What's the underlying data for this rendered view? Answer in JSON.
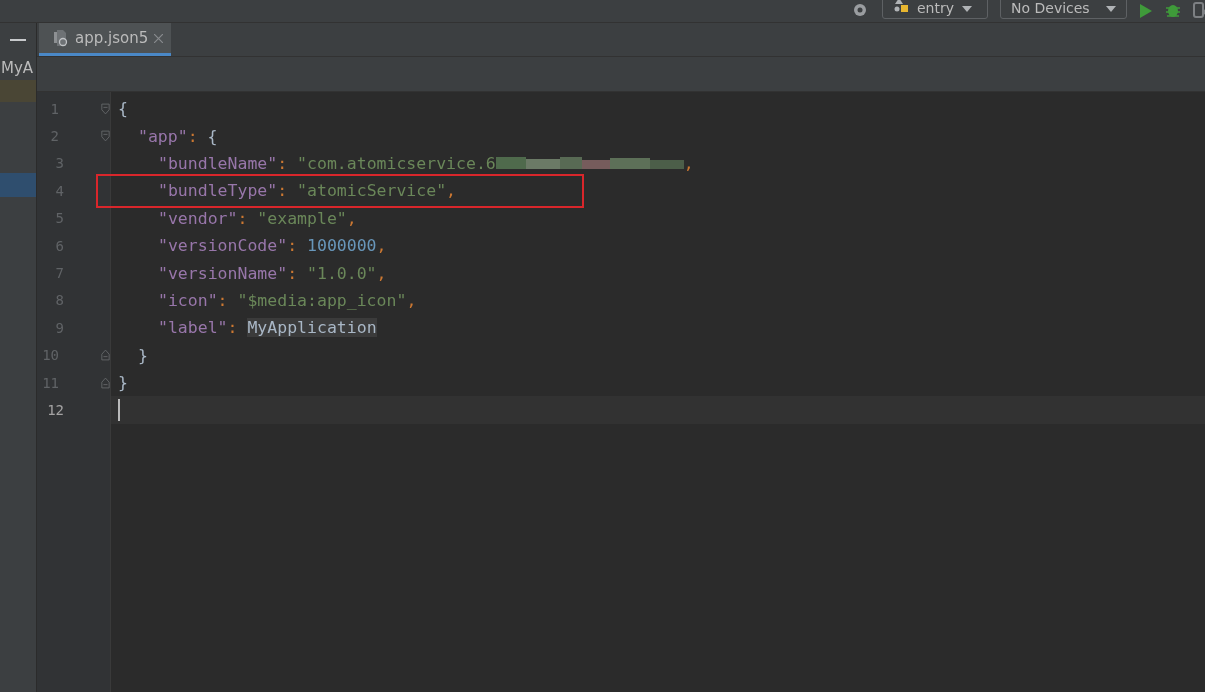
{
  "toolbar": {
    "run_config": "entry",
    "device": "No Devices"
  },
  "tabs": [
    {
      "label": "app.json5",
      "selected": true
    }
  ],
  "project_panel": {
    "label": "MyA"
  },
  "editor": {
    "lines": [
      {
        "number": "1",
        "kind": "fold_start",
        "current": false,
        "highlighted": false,
        "tokens": [
          {
            "kind": "plain",
            "text": "{"
          }
        ],
        "children": [
          {
            "number": "2",
            "kind": "fold_start",
            "current": false,
            "highlighted": false,
            "tokens": [
              {
                "kind": "key",
                "text": "\"app\""
              },
              {
                "kind": "punct",
                "text": ": "
              },
              {
                "kind": "plain",
                "text": "{"
              }
            ],
            "children": [
              {
                "number": "3",
                "current": false,
                "highlighted": false,
                "tokens": [
                  {
                    "kind": "key",
                    "text": "\"bundleName\""
                  },
                  {
                    "kind": "punct",
                    "text": ": "
                  },
                  {
                    "kind": "string",
                    "text": "\"com.atomicservice.6"
                  },
                  {
                    "kind": "redacted"
                  },
                  {
                    "kind": "punct",
                    "text": ","
                  }
                ]
              },
              {
                "number": "4",
                "current": false,
                "highlighted": true,
                "tokens": [
                  {
                    "kind": "key",
                    "text": "\"bundleType\""
                  },
                  {
                    "kind": "punct",
                    "text": ": "
                  },
                  {
                    "kind": "string",
                    "text": "\"atomicService\""
                  },
                  {
                    "kind": "punct",
                    "text": ","
                  }
                ]
              },
              {
                "number": "5",
                "current": false,
                "highlighted": false,
                "tokens": [
                  {
                    "kind": "key",
                    "text": "\"vendor\""
                  },
                  {
                    "kind": "punct",
                    "text": ": "
                  },
                  {
                    "kind": "string",
                    "text": "\"example\""
                  },
                  {
                    "kind": "punct",
                    "text": ","
                  }
                ]
              },
              {
                "number": "6",
                "current": false,
                "highlighted": false,
                "tokens": [
                  {
                    "kind": "key",
                    "text": "\"versionCode\""
                  },
                  {
                    "kind": "punct",
                    "text": ": "
                  },
                  {
                    "kind": "number",
                    "text": "1000000"
                  },
                  {
                    "kind": "punct",
                    "text": ","
                  }
                ]
              },
              {
                "number": "7",
                "current": false,
                "highlighted": false,
                "tokens": [
                  {
                    "kind": "key",
                    "text": "\"versionName\""
                  },
                  {
                    "kind": "punct",
                    "text": ": "
                  },
                  {
                    "kind": "string",
                    "text": "\"1.0.0\""
                  },
                  {
                    "kind": "punct",
                    "text": ","
                  }
                ]
              },
              {
                "number": "8",
                "current": false,
                "highlighted": false,
                "tokens": [
                  {
                    "kind": "key",
                    "text": "\"icon\""
                  },
                  {
                    "kind": "punct",
                    "text": ": "
                  },
                  {
                    "kind": "string",
                    "text": "\"$media:app_icon\""
                  },
                  {
                    "kind": "punct",
                    "text": ","
                  }
                ]
              },
              {
                "number": "9",
                "current": false,
                "highlighted": false,
                "tokens": [
                  {
                    "kind": "key",
                    "text": "\"label\""
                  },
                  {
                    "kind": "punct",
                    "text": ": "
                  },
                  {
                    "kind": "unresolved",
                    "text": "MyApplication"
                  }
                ]
              }
            ]
          },
          {
            "number": "10",
            "kind": "fold_end",
            "current": false,
            "highlighted": false,
            "tokens": [
              {
                "kind": "plain",
                "text": "}"
              }
            ]
          }
        ]
      },
      {
        "number": "11",
        "kind": "fold_end",
        "current": false,
        "highlighted": false,
        "tokens": [
          {
            "kind": "plain",
            "text": "}"
          }
        ]
      },
      {
        "number": "12",
        "current": true,
        "highlighted": false
      }
    ]
  }
}
